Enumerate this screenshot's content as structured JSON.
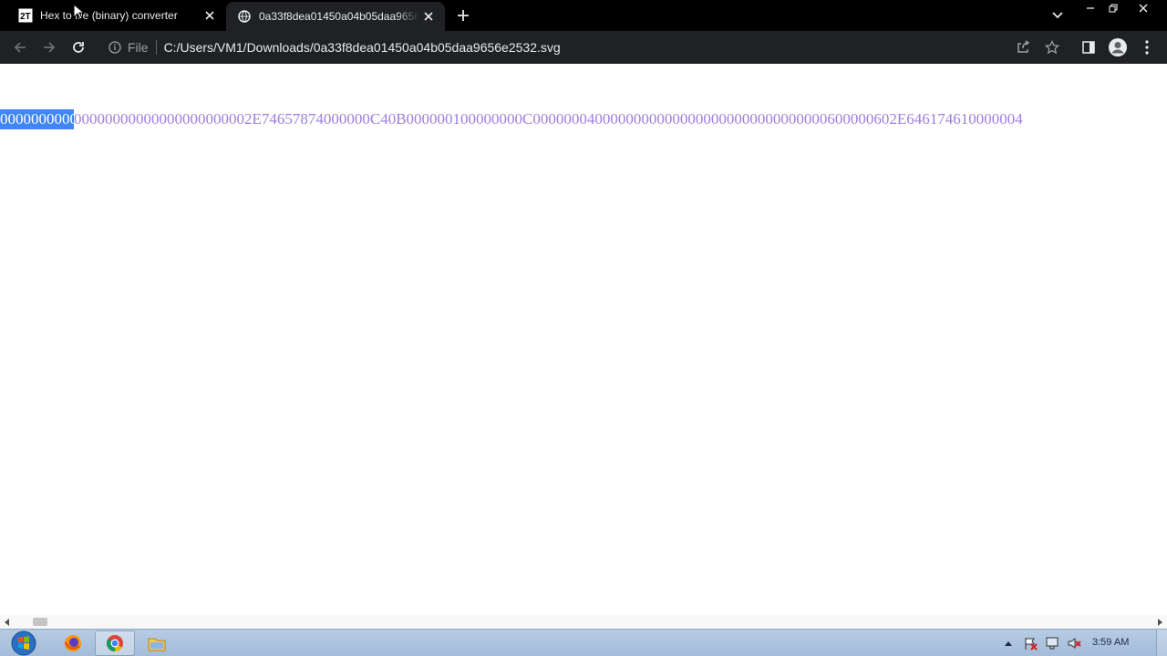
{
  "tabs": [
    {
      "title": "Hex to file (binary) converter",
      "favicon": "tool-site-icon"
    },
    {
      "title": "0a33f8dea01450a04b05daa9656e2532.svg",
      "favicon": "globe-icon"
    }
  ],
  "toolbar": {
    "scheme_label": "File",
    "url": "C:/Users/VM1/Downloads/0a33f8dea01450a04b05daa9656e2532.svg"
  },
  "page": {
    "selected_text": "000000000000",
    "hex_text": "00000000000000000000002E74657874000000C40B000000100000000C00000004000000000000000000000000000000600000602E646174610000004"
  },
  "taskbar": {
    "apps": [
      "firefox-icon",
      "chrome-icon",
      "file-explorer-icon"
    ],
    "clock": "3:59 AM"
  },
  "colors": {
    "tab_strip": "#000000",
    "toolbar": "#202124",
    "text_color": "#9c7fe0",
    "selection": "#3f86f7"
  }
}
